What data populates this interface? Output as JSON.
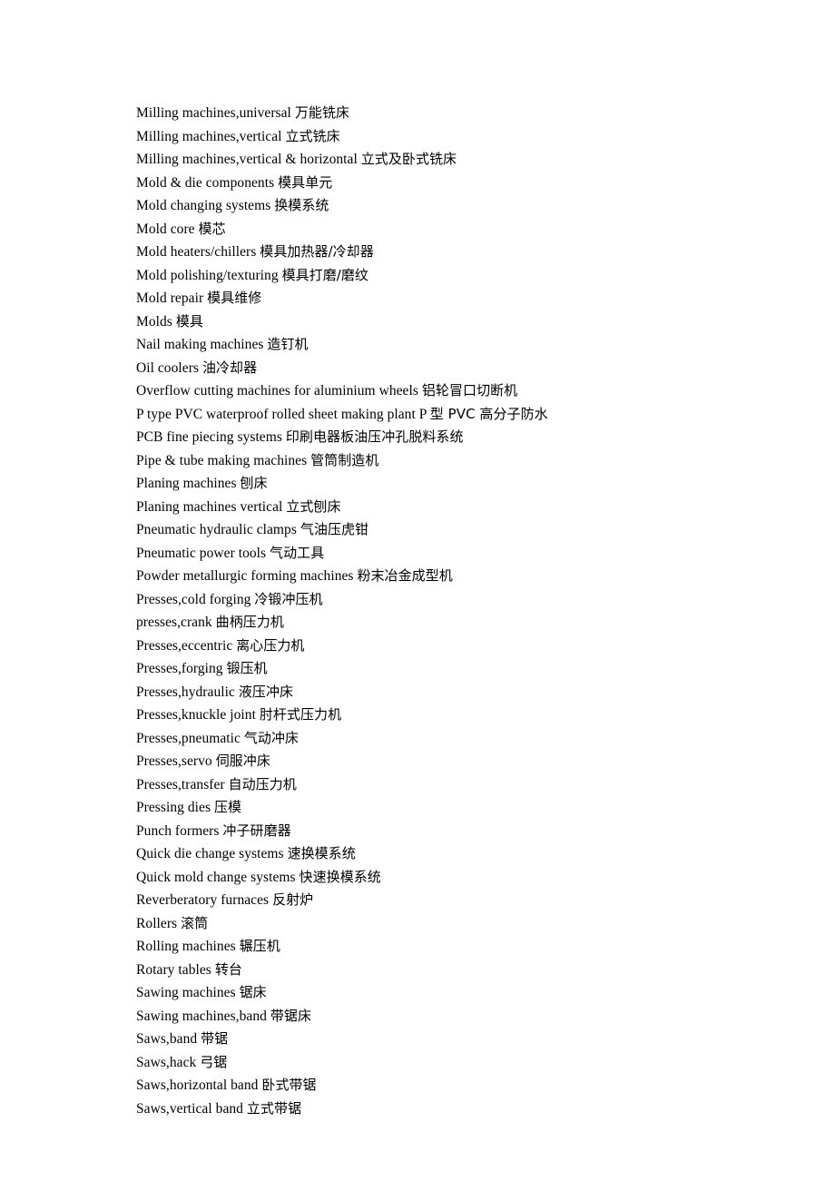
{
  "document": {
    "type": "bilingual-glossary",
    "background_color": "#ffffff",
    "text_color": "#000000",
    "entries": [
      {
        "english": "Milling machines,universal",
        "chinese": "万能铣床"
      },
      {
        "english": "Milling machines,vertical",
        "chinese": "立式铣床"
      },
      {
        "english": "Milling machines,vertical & horizontal",
        "chinese": "立式及卧式铣床"
      },
      {
        "english": "Mold & die components",
        "chinese": "模具单元"
      },
      {
        "english": "Mold changing systems",
        "chinese": "换模系统"
      },
      {
        "english": "Mold core",
        "chinese": "模芯"
      },
      {
        "english": "Mold heaters/chillers",
        "chinese": "模具加热器/冷却器"
      },
      {
        "english": "Mold polishing/texturing",
        "chinese": "模具打磨/磨纹"
      },
      {
        "english": "Mold repair",
        "chinese": "模具维修"
      },
      {
        "english": "Molds",
        "chinese": "模具"
      },
      {
        "english": "Nail making machines",
        "chinese": "造钉机"
      },
      {
        "english": "Oil coolers",
        "chinese": "油冷却器"
      },
      {
        "english": "Overflow cutting machines for aluminium wheels",
        "chinese": "铝轮冒口切断机"
      },
      {
        "english": "P type PVC waterproof rolled sheet making plant P",
        "chinese": "型 PVC 高分子防水"
      },
      {
        "english": "PCB fine piecing systems",
        "chinese": "印刷电器板油压冲孔脱料系统"
      },
      {
        "english": "Pipe & tube making machines",
        "chinese": "管筒制造机"
      },
      {
        "english": "Planing machines",
        "chinese": "刨床"
      },
      {
        "english": "Planing machines vertical",
        "chinese": "立式刨床"
      },
      {
        "english": "Pneumatic hydraulic clamps",
        "chinese": "气油压虎钳"
      },
      {
        "english": "Pneumatic power tools",
        "chinese": "气动工具"
      },
      {
        "english": "Powder metallurgic forming machines",
        "chinese": "粉末冶金成型机"
      },
      {
        "english": "Presses,cold forging",
        "chinese": "冷锻冲压机"
      },
      {
        "english": "presses,crank",
        "chinese": "曲柄压力机"
      },
      {
        "english": "Presses,eccentric",
        "chinese": "离心压力机"
      },
      {
        "english": "Presses,forging",
        "chinese": "锻压机"
      },
      {
        "english": "Presses,hydraulic",
        "chinese": "液压冲床"
      },
      {
        "english": "Presses,knuckle joint",
        "chinese": "肘杆式压力机"
      },
      {
        "english": "Presses,pneumatic",
        "chinese": "气动冲床"
      },
      {
        "english": "Presses,servo",
        "chinese": "伺服冲床"
      },
      {
        "english": "Presses,transfer",
        "chinese": "自动压力机"
      },
      {
        "english": "Pressing dies",
        "chinese": "压模"
      },
      {
        "english": "Punch formers",
        "chinese": "冲子研磨器"
      },
      {
        "english": "Quick die change systems",
        "chinese": "速换模系统"
      },
      {
        "english": "Quick mold change systems",
        "chinese": "快速换模系统"
      },
      {
        "english": "Reverberatory furnaces",
        "chinese": "反射炉"
      },
      {
        "english": "Rollers",
        "chinese": "滚筒"
      },
      {
        "english": "Rolling machines",
        "chinese": "辗压机"
      },
      {
        "english": "Rotary tables",
        "chinese": "转台"
      },
      {
        "english": "Sawing machines",
        "chinese": "锯床"
      },
      {
        "english": "Sawing machines,band",
        "chinese": "带锯床"
      },
      {
        "english": "Saws,band",
        "chinese": "带锯"
      },
      {
        "english": "Saws,hack",
        "chinese": "弓锯"
      },
      {
        "english": "Saws,horizontal band",
        "chinese": "卧式带锯"
      },
      {
        "english": "Saws,vertical band",
        "chinese": "立式带锯"
      }
    ]
  }
}
